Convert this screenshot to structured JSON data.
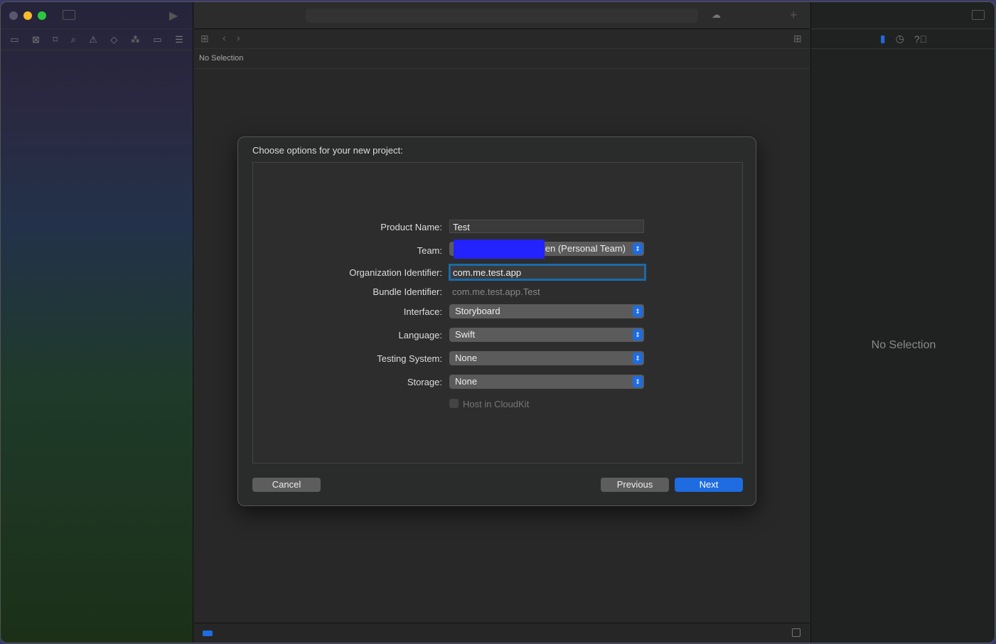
{
  "navigator": {
    "icons": [
      "folder-icon",
      "source-control-icon",
      "bookmark-icon",
      "search-icon",
      "warning-icon",
      "test-icon",
      "debug-icon",
      "breakpoint-icon",
      "report-icon"
    ]
  },
  "editor": {
    "jump_bar": "No Selection"
  },
  "inspector": {
    "no_selection": "No Selection"
  },
  "dialog": {
    "title": "Choose options for your new project:",
    "product_name_label": "Product Name:",
    "product_name": "Test",
    "team_label": "Team:",
    "team_value": "en (Personal Team)",
    "org_label": "Organization Identifier:",
    "org_value": "com.me.test.app",
    "bundle_label": "Bundle Identifier:",
    "bundle_value": "com.me.test.app.Test",
    "interface_label": "Interface:",
    "interface_value": "Storyboard",
    "language_label": "Language:",
    "language_value": "Swift",
    "testing_label": "Testing System:",
    "testing_value": "None",
    "storage_label": "Storage:",
    "storage_value": "None",
    "cloudkit_label": "Host in CloudKit",
    "cancel": "Cancel",
    "previous": "Previous",
    "next": "Next"
  },
  "colors": {
    "accent": "#1e6ce0",
    "redaction": "#2323ff"
  }
}
